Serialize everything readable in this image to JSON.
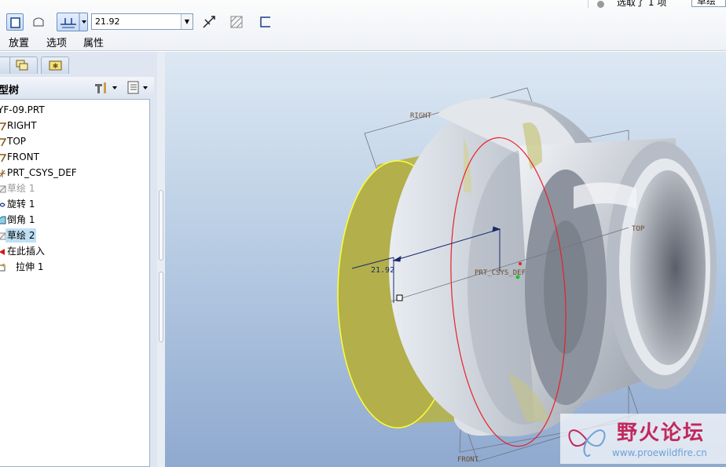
{
  "dashboard": {
    "depth_value": "21.92",
    "tabs": [
      "放置",
      "选项",
      "属性"
    ]
  },
  "status": {
    "selection_text": "选取了 1 项",
    "filter_value": "草绘"
  },
  "model_tree": {
    "title": "型树",
    "items": [
      {
        "label": "YF-09.PRT",
        "icon": "part-icon"
      },
      {
        "label": "RIGHT",
        "icon": "datum-plane-icon"
      },
      {
        "label": "TOP",
        "icon": "datum-plane-icon"
      },
      {
        "label": "FRONT",
        "icon": "datum-plane-icon"
      },
      {
        "label": "PRT_CSYS_DEF",
        "icon": "csys-icon"
      },
      {
        "label": "草绘 1",
        "icon": "sketch-icon"
      },
      {
        "label": "旋转 1",
        "icon": "revolve-icon"
      },
      {
        "label": "倒角 1",
        "icon": "chamfer-icon"
      },
      {
        "label": "草绘 2",
        "icon": "sketch-icon"
      },
      {
        "label": "在此插入",
        "icon": "insert-here-icon"
      },
      {
        "label": "拉伸 1",
        "icon": "extrude-icon"
      }
    ]
  },
  "viewport": {
    "datum_labels": {
      "right": "RIGHT",
      "top": "TOP",
      "front": "FRONT",
      "csys": "PRT_CSYS_DEF"
    },
    "dimension_text": "21.92",
    "watermark": {
      "name": "野火论坛",
      "url": "www.proewildfire.cn"
    }
  },
  "colors": {
    "preview_fill": "#b5b24a",
    "preview_edge": "#ffff33",
    "section_curve": "#e8202a",
    "dimension": "#1a2a6c"
  }
}
